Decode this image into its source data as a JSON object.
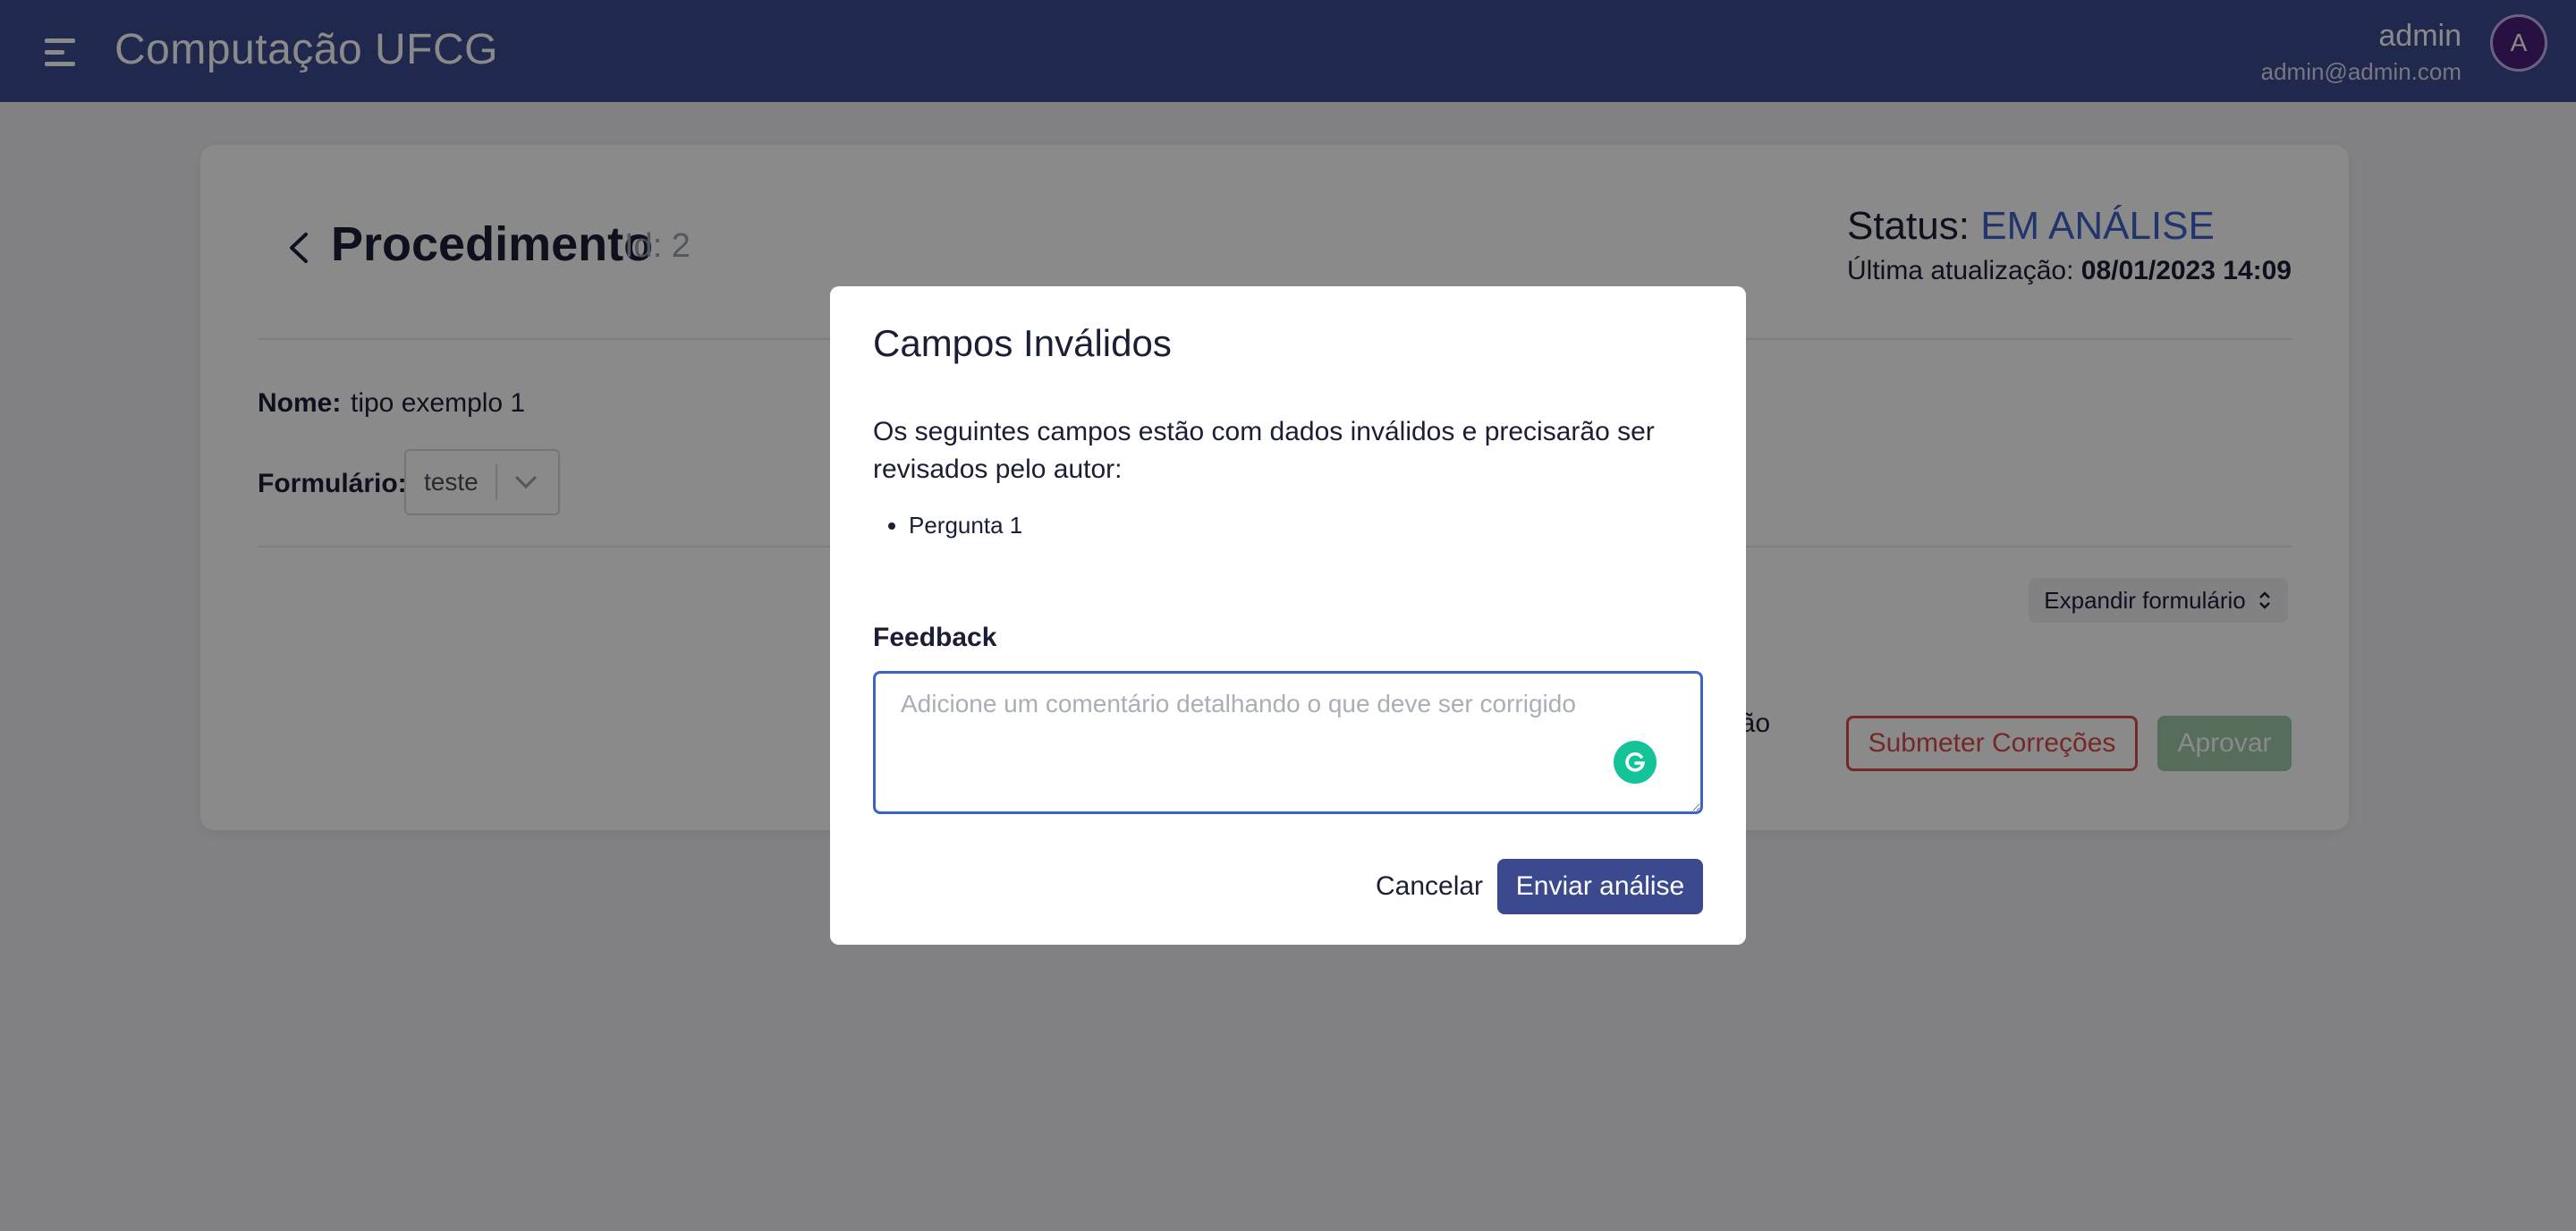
{
  "header": {
    "app_title": "Computação UFCG",
    "user_name": "admin",
    "user_email": "admin@admin.com",
    "avatar_initial": "A",
    "menu_icon": "hamburger-menu-icon"
  },
  "procedure": {
    "title": "Procedimento",
    "id_label": "Id: 2",
    "status_label": "Status:",
    "status_value": "EM ANÁLISE",
    "update_label": "Última atualização:",
    "update_value": "08/01/2023 14:09",
    "name_label": "Nome:",
    "name_value": "tipo exemplo 1",
    "form_label": "Formulário:",
    "form_selected": "teste",
    "expand_label": "Expandir formulário",
    "correction_label": "reção",
    "submit_corrections_label": "Submeter Correções",
    "approve_label": "Aprovar"
  },
  "modal": {
    "title": "Campos Inválidos",
    "description": "Os seguintes campos estão com dados inválidos e precisarão ser revisados pelo autor:",
    "invalid_fields": [
      "Pergunta 1"
    ],
    "feedback_label": "Feedback",
    "feedback_placeholder": "Adicione um comentário detalhando o que deve ser corrigido",
    "feedback_value": "",
    "cancel_label": "Cancelar",
    "send_label": "Enviar análise"
  },
  "colors": {
    "header_bg": "#3b4a8f",
    "status_blue": "#3d63c9",
    "danger": "#d84a4a",
    "approve_disabled": "#9dc9a6",
    "grammarly": "#15c39a"
  }
}
